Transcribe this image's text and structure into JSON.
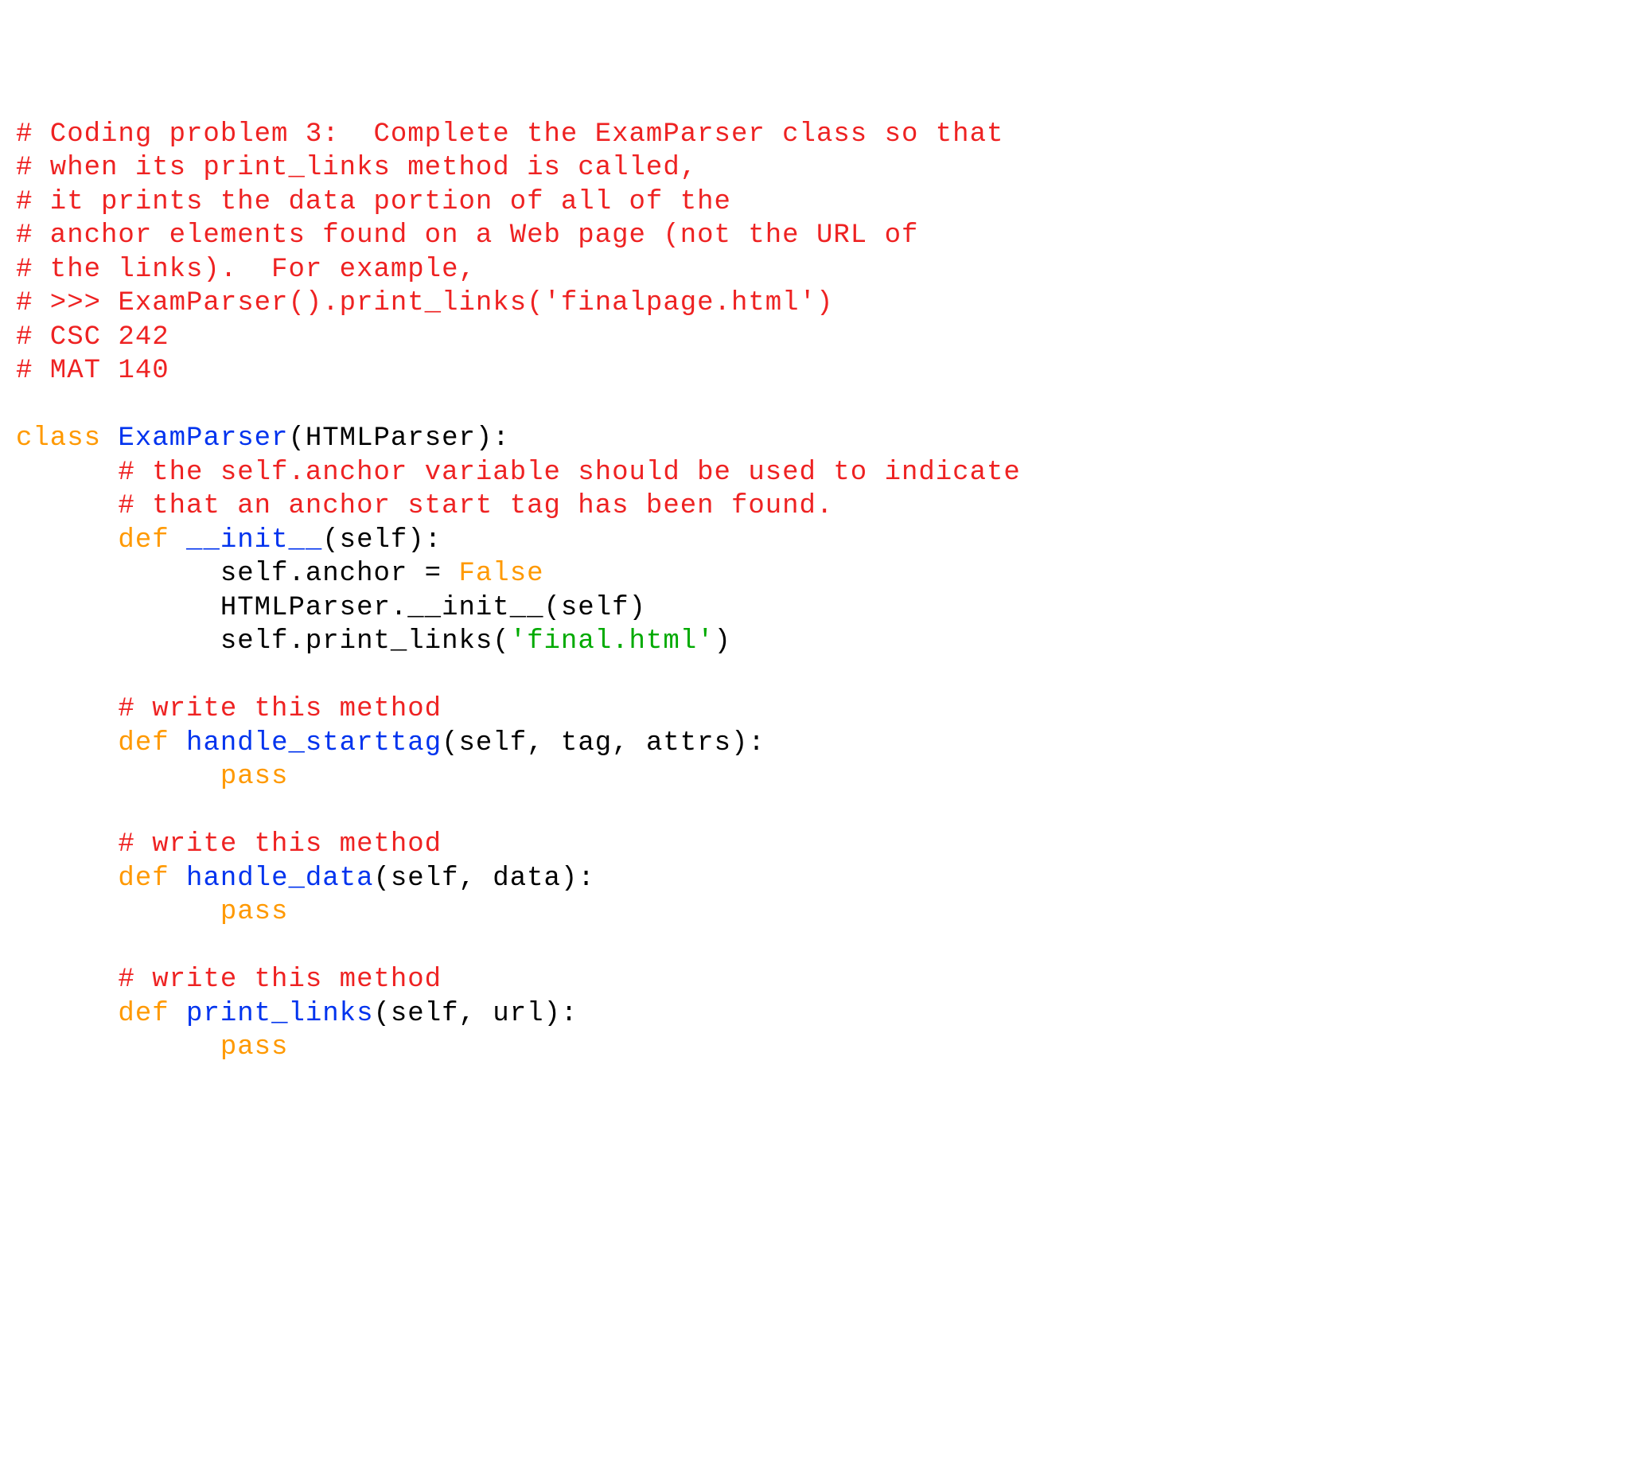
{
  "lines": [
    [
      {
        "cls": "c-comment",
        "text": "# Coding problem 3:  Complete the ExamParser class so that"
      }
    ],
    [
      {
        "cls": "c-comment",
        "text": "# when its print_links method is called,"
      }
    ],
    [
      {
        "cls": "c-comment",
        "text": "# it prints the data portion of all of the"
      }
    ],
    [
      {
        "cls": "c-comment",
        "text": "# anchor elements found on a Web page (not the URL of"
      }
    ],
    [
      {
        "cls": "c-comment",
        "text": "# the links).  For example,"
      }
    ],
    [
      {
        "cls": "c-comment",
        "text": "# >>> ExamParser().print_links('finalpage.html')"
      }
    ],
    [
      {
        "cls": "c-comment",
        "text": "# CSC 242"
      }
    ],
    [
      {
        "cls": "c-comment",
        "text": "# MAT 140"
      }
    ],
    [
      {
        "cls": "c-ident",
        "text": ""
      }
    ],
    [
      {
        "cls": "c-keyword",
        "text": "class "
      },
      {
        "cls": "c-fname",
        "text": "ExamParser"
      },
      {
        "cls": "c-ident",
        "text": "(HTMLParser):"
      }
    ],
    [
      {
        "cls": "c-ident",
        "text": "      "
      },
      {
        "cls": "c-comment",
        "text": "# the self.anchor variable should be used to indicate"
      }
    ],
    [
      {
        "cls": "c-ident",
        "text": "      "
      },
      {
        "cls": "c-comment",
        "text": "# that an anchor start tag has been found."
      }
    ],
    [
      {
        "cls": "c-ident",
        "text": "      "
      },
      {
        "cls": "c-keyword",
        "text": "def "
      },
      {
        "cls": "c-fname",
        "text": "__init__"
      },
      {
        "cls": "c-ident",
        "text": "(self):"
      }
    ],
    [
      {
        "cls": "c-ident",
        "text": "            self.anchor = "
      },
      {
        "cls": "c-keyword",
        "text": "False"
      }
    ],
    [
      {
        "cls": "c-ident",
        "text": "            HTMLParser.__init__(self)"
      }
    ],
    [
      {
        "cls": "c-ident",
        "text": "            self.print_links("
      },
      {
        "cls": "c-string",
        "text": "'final.html'"
      },
      {
        "cls": "c-ident",
        "text": ")"
      }
    ],
    [
      {
        "cls": "c-ident",
        "text": ""
      }
    ],
    [
      {
        "cls": "c-ident",
        "text": "      "
      },
      {
        "cls": "c-comment",
        "text": "# write this method"
      }
    ],
    [
      {
        "cls": "c-ident",
        "text": "      "
      },
      {
        "cls": "c-keyword",
        "text": "def "
      },
      {
        "cls": "c-fname",
        "text": "handle_starttag"
      },
      {
        "cls": "c-ident",
        "text": "(self, tag, attrs):"
      }
    ],
    [
      {
        "cls": "c-ident",
        "text": "            "
      },
      {
        "cls": "c-keyword",
        "text": "pass"
      }
    ],
    [
      {
        "cls": "c-ident",
        "text": ""
      }
    ],
    [
      {
        "cls": "c-ident",
        "text": "      "
      },
      {
        "cls": "c-comment",
        "text": "# write this method"
      }
    ],
    [
      {
        "cls": "c-ident",
        "text": "      "
      },
      {
        "cls": "c-keyword",
        "text": "def "
      },
      {
        "cls": "c-fname",
        "text": "handle_data"
      },
      {
        "cls": "c-ident",
        "text": "(self, data):"
      }
    ],
    [
      {
        "cls": "c-ident",
        "text": "            "
      },
      {
        "cls": "c-keyword",
        "text": "pass"
      }
    ],
    [
      {
        "cls": "c-ident",
        "text": ""
      }
    ],
    [
      {
        "cls": "c-ident",
        "text": "      "
      },
      {
        "cls": "c-comment",
        "text": "# write this method"
      }
    ],
    [
      {
        "cls": "c-ident",
        "text": "      "
      },
      {
        "cls": "c-keyword",
        "text": "def "
      },
      {
        "cls": "c-fname",
        "text": "print_links"
      },
      {
        "cls": "c-ident",
        "text": "(self, url):"
      }
    ],
    [
      {
        "cls": "c-ident",
        "text": "            "
      },
      {
        "cls": "c-keyword",
        "text": "pass"
      }
    ]
  ]
}
